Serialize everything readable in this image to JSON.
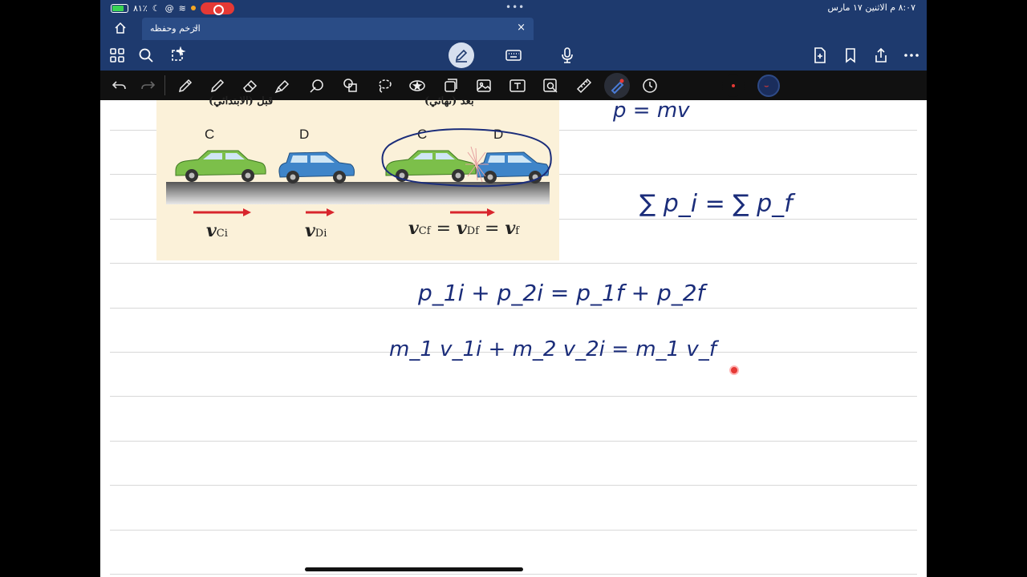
{
  "status_bar": {
    "battery": "٨١٪",
    "datetime": "٨:٠٧ م  الاثنين ١٧ مارس",
    "center_dots": "•••"
  },
  "tab": {
    "title": "الزخم وحفظه",
    "chevron": "⌄",
    "close": "×"
  },
  "figure": {
    "before_label": "قبل (الابتدائي)",
    "after_label": "بعد (نهائي)",
    "car_c": "C",
    "car_d": "D",
    "car_c2": "C",
    "car_d2": "D",
    "v1": "v",
    "v1_sub": "Ci",
    "v2": "v",
    "v2_sub": "Di",
    "v3": "v",
    "v3_sub": "Cf",
    "v4": "v",
    "v4_sub": "Df",
    "v5": "v",
    "v5_sub": "f",
    "eq1": "=",
    "eq2": "="
  },
  "ink": {
    "line1": "p = mv",
    "line2": "∑ p_i  =  ∑ p_f",
    "line3": "p_1i  +  p_2i  =  p_1f  +  p_2f",
    "line4": "m_1 v_1i  +  m_2 v_2i  =  m_1 v_f"
  },
  "colors": {
    "accent": "#1e3a6e",
    "ink": "#1b2d7a",
    "red": "#e53935"
  }
}
